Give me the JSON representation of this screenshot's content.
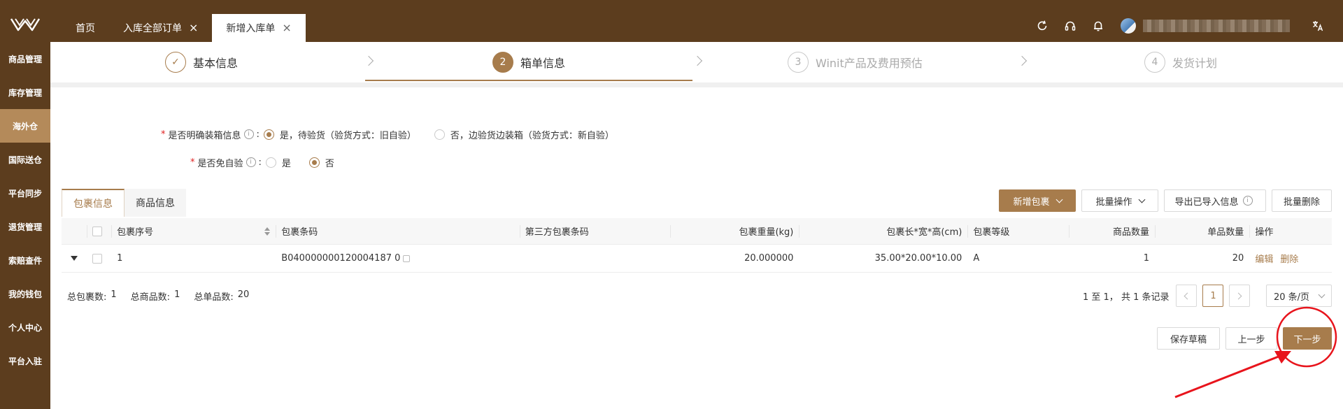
{
  "header": {
    "tabs": [
      {
        "label": "首页",
        "closable": false,
        "active": false
      },
      {
        "label": "入库全部订单",
        "closable": true,
        "active": false
      },
      {
        "label": "新增入库单",
        "closable": true,
        "active": true
      }
    ],
    "close_glyph": "×",
    "icons": [
      "refresh-icon",
      "headset-icon",
      "bell-icon",
      "translate-icon"
    ]
  },
  "sidebar": {
    "items": [
      {
        "label": "商品管理",
        "active": false
      },
      {
        "label": "库存管理",
        "active": false
      },
      {
        "label": "海外仓",
        "active": true
      },
      {
        "label": "国际送仓",
        "active": false
      },
      {
        "label": "平台同步",
        "active": false
      },
      {
        "label": "退货管理",
        "active": false
      },
      {
        "label": "索赔查件",
        "active": false
      },
      {
        "label": "我的钱包",
        "active": false
      },
      {
        "label": "个人中心",
        "active": false
      },
      {
        "label": "平台入驻",
        "active": false
      }
    ]
  },
  "steps": [
    {
      "num": "✓",
      "label": "基本信息",
      "state": "done"
    },
    {
      "num": "2",
      "label": "箱单信息",
      "state": "current"
    },
    {
      "num": "3",
      "label": "Winit产品及费用预估",
      "state": "todo"
    },
    {
      "num": "4",
      "label": "发货计划",
      "state": "todo"
    }
  ],
  "form": {
    "q1": {
      "required": "*",
      "label": "是否明确装箱信息",
      "colon": ":",
      "options": [
        {
          "label": "是，待验货（验货方式：旧自验）",
          "checked": true
        },
        {
          "label": "否，边验货边装箱（验货方式：新自验）",
          "checked": false
        }
      ]
    },
    "q2": {
      "required": "*",
      "label": "是否免自验",
      "colon": ":",
      "options": [
        {
          "label": "是",
          "checked": false
        },
        {
          "label": "否",
          "checked": true
        }
      ]
    }
  },
  "subtabs": [
    {
      "label": "包裹信息",
      "active": true
    },
    {
      "label": "商品信息",
      "active": false
    }
  ],
  "toolbar": {
    "add_package": "新增包裹",
    "batch_ops": "批量操作",
    "export_imported": "导出已导入信息",
    "batch_delete": "批量删除"
  },
  "table": {
    "headers": [
      "包裹序号",
      "包裹条码",
      "第三方包裹条码",
      "包裹重量(kg)",
      "包裹长*宽*高(cm)",
      "包裹等级",
      "商品数量",
      "单品数量",
      "操作"
    ],
    "rows": [
      {
        "seq": "1",
        "barcode": "B040000000120004187 0",
        "third_party": "",
        "weight": "20.000000",
        "dims": "35.00*20.00*10.00",
        "grade": "A",
        "goods_qty": "1",
        "unit_qty": "20",
        "actions": [
          "编辑",
          "删除"
        ]
      }
    ]
  },
  "summary": {
    "packages_label": "总包裹数:",
    "packages": "1",
    "goods_label": "总商品数:",
    "goods": "1",
    "units_label": "总单品数:",
    "units": "20"
  },
  "pagination": {
    "range_text": "1 至 1，  共 1 条记录",
    "current_page": "1",
    "page_size": "20 条/页"
  },
  "actions": {
    "save_draft": "保存草稿",
    "prev": "上一步",
    "next": "下一步"
  },
  "colors": {
    "brand_dark": "#5c3d1e",
    "brand_accent": "#a77c4c",
    "annotation_red": "#e8141c"
  }
}
